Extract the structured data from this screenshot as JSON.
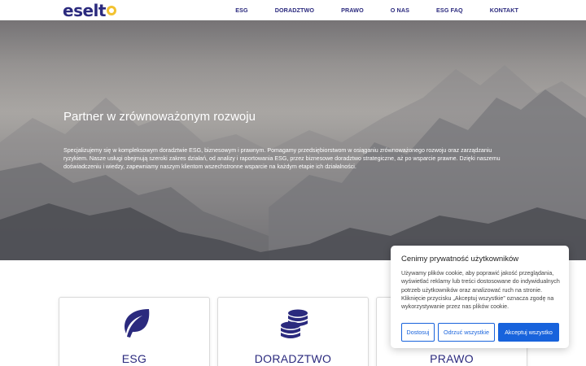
{
  "brand": {
    "logo_text": "eselt",
    "logo_accent": "o",
    "primary_color": "#2b2a7e",
    "accent_color": "#f2c230"
  },
  "nav": {
    "items": [
      {
        "label": "ESG"
      },
      {
        "label": "DORADZTWO"
      },
      {
        "label": "PRAWO"
      },
      {
        "label": "O NAS"
      },
      {
        "label": "ESG FAQ"
      },
      {
        "label": "KONTAKT"
      }
    ]
  },
  "hero": {
    "title": "Partner w zrównoważonym rozwoju",
    "text": "Specjalizujemy się w kompleksowym doradztwie ESG, biznesowym i prawnym. Pomagamy przedsiębiorstwom w osiąganiu zrównoważonego rozwoju oraz zarządzaniu ryzykiem. Nasze usługi obejmują szeroki zakres działań, od analizy i raportowania ESG, przez biznesowe doradztwo strategiczne, aż po wsparcie prawne. Dzięki naszemu doświadczeniu i wiedzy, zapewniamy naszym klientom wszechstronne wsparcie na każdym etapie ich działalności."
  },
  "cards": [
    {
      "title": "ESG",
      "icon": "leaf-icon"
    },
    {
      "title": "DORADZTWO",
      "icon": "coins-icon"
    },
    {
      "title": "PRAWO",
      "icon": "scales-icon"
    }
  ],
  "cookie": {
    "title": "Cenimy prywatność użytkowników",
    "text": "Używamy plików cookie, aby poprawić jakość przeglądania, wyświetlać reklamy lub treści dostosowane do indywidualnych potrzeb użytkowników oraz analizować ruch na stronie. Kliknięcie przycisku „Akceptuj wszystkie” oznacza zgodę na wykorzystywanie przez nas plików cookie.",
    "customize_label": "Dostosuj",
    "reject_label": "Odrzuć wszystkie",
    "accept_label": "Akceptuj wszystko",
    "button_color": "#1863dc"
  }
}
